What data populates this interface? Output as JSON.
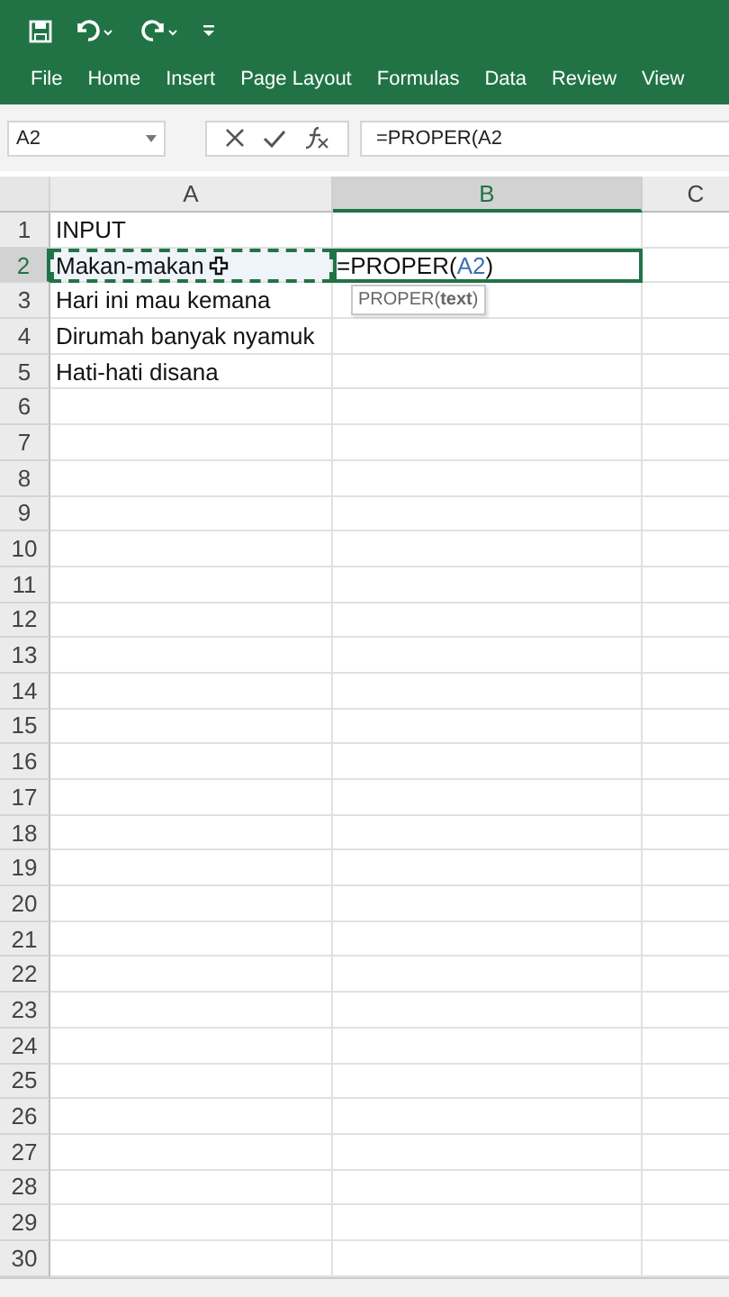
{
  "quick_access": [
    {
      "kind": "save"
    },
    {
      "kind": "undo"
    },
    {
      "kind": "redo"
    },
    {
      "kind": "customize"
    }
  ],
  "ribbon_tabs": [
    {
      "label": "File",
      "selected": false
    },
    {
      "label": "Home",
      "selected": false
    },
    {
      "label": "Insert",
      "selected": false
    },
    {
      "label": "Page Layout",
      "selected": false
    },
    {
      "label": "Formulas",
      "selected": false
    },
    {
      "label": "Data",
      "selected": false
    },
    {
      "label": "Review",
      "selected": false
    },
    {
      "label": "View",
      "selected": false
    }
  ],
  "name_box": "A2",
  "formula_bar": {
    "value": "=PROPER(A2"
  },
  "columns": [
    {
      "label": "A",
      "selected": false
    },
    {
      "label": "B",
      "selected": true
    },
    {
      "label": "C",
      "selected": false
    }
  ],
  "rows": [
    {
      "label": "1",
      "selected": false,
      "cells": [
        "INPUT",
        "",
        ""
      ]
    },
    {
      "label": "2",
      "selected": true,
      "cells": [
        "Makan-makan",
        "",
        ""
      ],
      "copy_source": [
        true,
        false,
        false
      ],
      "editing": [
        false,
        true,
        false
      ]
    },
    {
      "label": "3",
      "selected": false,
      "cells": [
        "Hari ini mau kemana",
        "",
        ""
      ]
    },
    {
      "label": "4",
      "selected": false,
      "cells": [
        "Dirumah banyak nyamuk",
        "",
        ""
      ]
    },
    {
      "label": "5",
      "selected": false,
      "cells": [
        "Hati-hati disana",
        "",
        ""
      ]
    },
    {
      "label": "6",
      "selected": false,
      "cells": [
        "",
        "",
        ""
      ]
    },
    {
      "label": "7",
      "selected": false,
      "cells": [
        "",
        "",
        ""
      ]
    },
    {
      "label": "8",
      "selected": false,
      "cells": [
        "",
        "",
        ""
      ]
    },
    {
      "label": "9",
      "selected": false,
      "cells": [
        "",
        "",
        ""
      ]
    },
    {
      "label": "10",
      "selected": false,
      "cells": [
        "",
        "",
        ""
      ]
    },
    {
      "label": "11",
      "selected": false,
      "cells": [
        "",
        "",
        ""
      ]
    },
    {
      "label": "12",
      "selected": false,
      "cells": [
        "",
        "",
        ""
      ]
    },
    {
      "label": "13",
      "selected": false,
      "cells": [
        "",
        "",
        ""
      ]
    },
    {
      "label": "14",
      "selected": false,
      "cells": [
        "",
        "",
        ""
      ]
    },
    {
      "label": "15",
      "selected": false,
      "cells": [
        "",
        "",
        ""
      ]
    },
    {
      "label": "16",
      "selected": false,
      "cells": [
        "",
        "",
        ""
      ]
    },
    {
      "label": "17",
      "selected": false,
      "cells": [
        "",
        "",
        ""
      ]
    },
    {
      "label": "18",
      "selected": false,
      "cells": [
        "",
        "",
        ""
      ]
    },
    {
      "label": "19",
      "selected": false,
      "cells": [
        "",
        "",
        ""
      ]
    },
    {
      "label": "20",
      "selected": false,
      "cells": [
        "",
        "",
        ""
      ]
    },
    {
      "label": "21",
      "selected": false,
      "cells": [
        "",
        "",
        ""
      ]
    },
    {
      "label": "22",
      "selected": false,
      "cells": [
        "",
        "",
        ""
      ]
    },
    {
      "label": "23",
      "selected": false,
      "cells": [
        "",
        "",
        ""
      ]
    },
    {
      "label": "24",
      "selected": false,
      "cells": [
        "",
        "",
        ""
      ]
    },
    {
      "label": "25",
      "selected": false,
      "cells": [
        "",
        "",
        ""
      ]
    },
    {
      "label": "26",
      "selected": false,
      "cells": [
        "",
        "",
        ""
      ]
    },
    {
      "label": "27",
      "selected": false,
      "cells": [
        "",
        "",
        ""
      ]
    },
    {
      "label": "28",
      "selected": false,
      "cells": [
        "",
        "",
        ""
      ]
    },
    {
      "label": "29",
      "selected": false,
      "cells": [
        "",
        "",
        ""
      ]
    },
    {
      "label": "30",
      "selected": false,
      "cells": [
        "",
        "",
        ""
      ]
    }
  ],
  "editing_cell": {
    "parts": [
      {
        "text": "=PROPER(",
        "kind": "plain"
      },
      {
        "text": "A2",
        "kind": "ref"
      },
      {
        "text": ")",
        "kind": "plain"
      }
    ]
  },
  "tooltip": "PROPER(**text**)"
}
